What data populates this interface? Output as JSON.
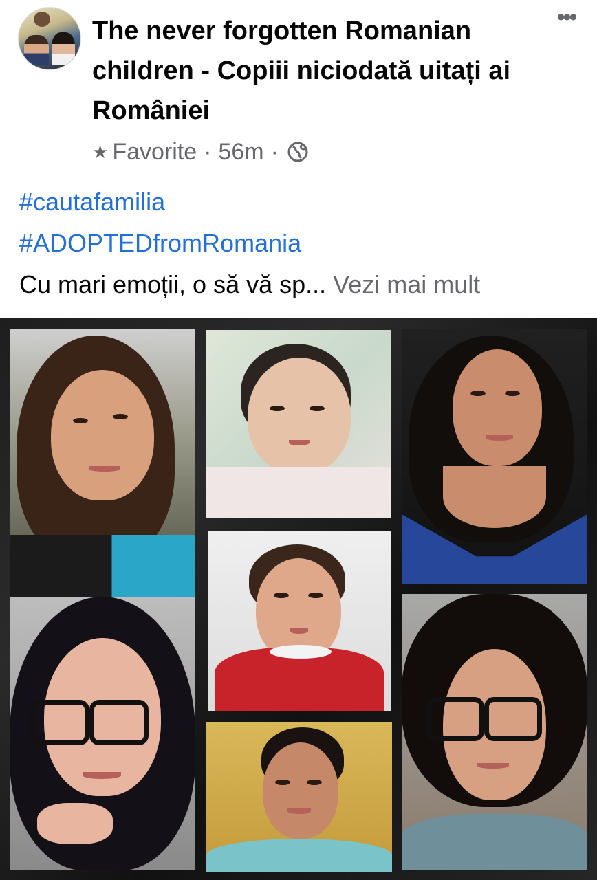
{
  "post": {
    "page_name": "The never forgotten Romanian children - Copiii niciodată uitați ai României",
    "meta": {
      "favorite_label": "Favorite",
      "separator": "·",
      "time": "56m",
      "audience_icon": "globe-icon"
    },
    "hashtags": [
      "#cautafamilia",
      "#ADOPTEDfromRomania"
    ],
    "text_preview": "Cu mari emoții, o să vă sp...",
    "see_more": "Vezi mai mult",
    "more_icon": "•••"
  },
  "collage": {
    "photos": [
      "woman-long-brown-hair",
      "baby-portrait",
      "woman-blue-dress",
      "toddler-red-dress",
      "woman-glasses-dark-hair",
      "woman-hair-bun",
      "woman-curly-hair-glasses"
    ]
  },
  "colors": {
    "link_blue": "#216fdb",
    "secondary_text": "#65676b",
    "primary_text": "#050505",
    "collage_bg": "#1e1e1e"
  }
}
